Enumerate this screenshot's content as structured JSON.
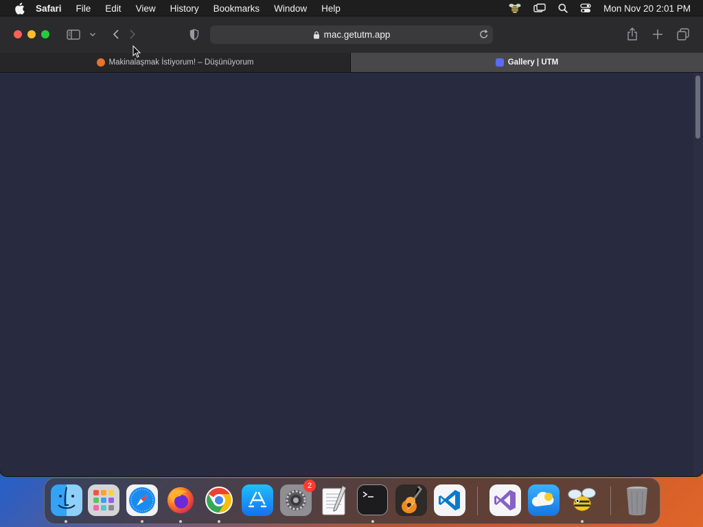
{
  "menubar": {
    "app_name": "Safari",
    "items": [
      "File",
      "Edit",
      "View",
      "History",
      "Bookmarks",
      "Window",
      "Help"
    ],
    "clock": "Mon Nov 20  2:01 PM"
  },
  "toolbar": {
    "address": "mac.getutm.app"
  },
  "tabs": [
    {
      "title": "Makinalaşmak İstiyorum! – Düşünüyorum",
      "favicon_color": "#e8732c"
    },
    {
      "title": "Gallery | UTM",
      "favicon_color": "#5b6cf0"
    }
  ],
  "dock": {
    "apps": [
      "Finder",
      "Launchpad",
      "Safari",
      "Firefox",
      "Google Chrome",
      "App Store",
      "System Settings",
      "TextEdit",
      "Terminal",
      "GarageBand",
      "Visual Studio Code",
      "Visual Studio",
      "iCloud",
      "Cyberduck",
      "Trash"
    ],
    "settings_badge": "2"
  },
  "colors": {
    "page_bg": "#282a3f",
    "toolbar_bg": "#2b2b2d",
    "active_tab_bg": "#48484b"
  }
}
